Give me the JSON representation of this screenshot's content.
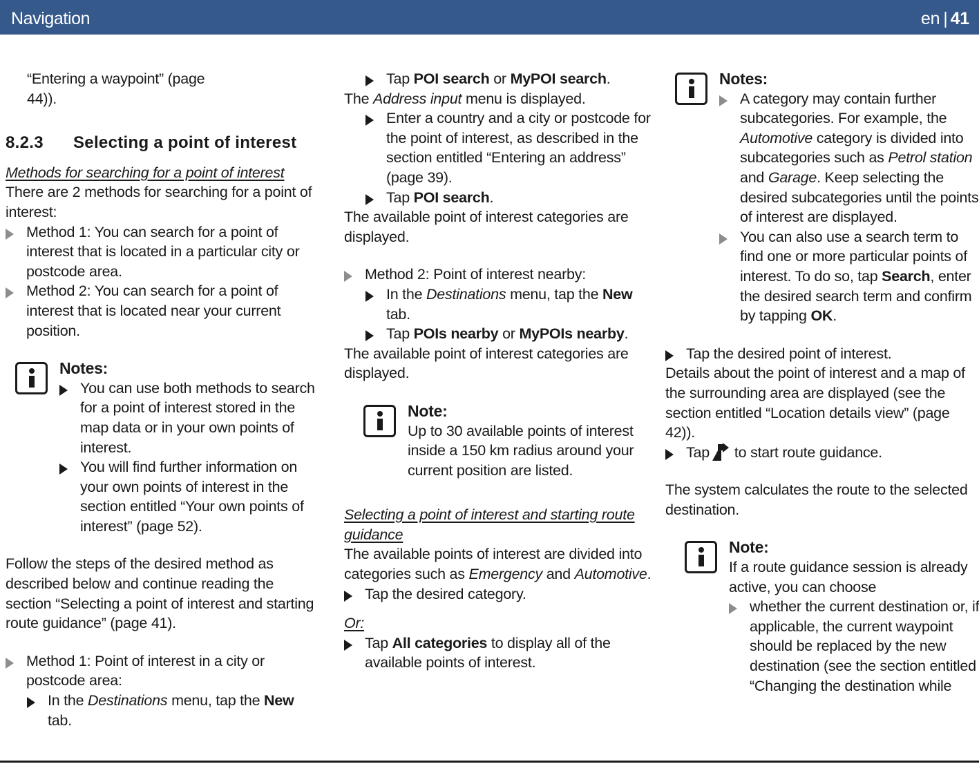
{
  "header": {
    "title": "Navigation",
    "language": "en",
    "separator": "|",
    "page_number": "41"
  },
  "column_1": {
    "continued_ref_line_1": "“Entering a waypoint” (page",
    "continued_ref_line_2": "44)).",
    "section_number": "8.2.3",
    "section_title": "Selecting a point of interest",
    "sub_heading": "Methods for searching for a point of interest",
    "intro_paragraph": "There are 2 methods for searching for a point of interest:",
    "method_1_bullet": "Method 1: You can search for a point of interest that is located in a particular city or postcode area.",
    "method_2_bullet": "Method 2: You can search for a point of interest that is located near your current position.",
    "notes_title": "Notes:",
    "note_bullet_1": "You can use both methods to search for a point of interest stored in the map data or in your own points of interest.",
    "note_bullet_2_a": "You will find further information on your own points of interest in the section entitled “Your own points of interest” (page 52).",
    "follow_paragraph": "Follow the steps of the desired method as described below and continue reading the section “Selecting a point of interest and starting route guidance” (page 41).",
    "method_1_step": "Method 1: Point of interest in a city or postcode area:",
    "step_in_destinations_a": "In the ",
    "step_in_destinations_italic": "Destinations",
    "step_in_destinations_b": " menu, tap the ",
    "step_in_destinations_bold": "New",
    "step_in_destinations_c": " tab."
  },
  "column_2": {
    "tap_poi_search_a": "Tap ",
    "tap_poi_search_bold_1": "POI search",
    "tap_poi_search_b": " or ",
    "tap_poi_search_bold_2": "MyPOI search",
    "tap_poi_search_c": ".",
    "address_input_a": "The ",
    "address_input_italic": "Address input",
    "address_input_b": " menu is displayed.",
    "enter_country_bullet": "Enter a country and a city or postcode for the point of interest, as described in the section entitled “Entering an address” (page 39).",
    "tap_poi_search_2_a": "Tap ",
    "tap_poi_search_2_bold": "POI search",
    "tap_poi_search_2_b": ".",
    "categories_displayed": "The available point of interest categories are displayed.",
    "method_2_step": "Method 2: Point of interest nearby:",
    "step_in_destinations_a": "In the ",
    "step_in_destinations_italic": "Destinations",
    "step_in_destinations_b": " menu, tap the ",
    "step_in_destinations_bold": "New",
    "step_in_destinations_c": " tab.",
    "tap_pois_nearby_a": "Tap ",
    "tap_pois_nearby_bold_1": "POIs nearby",
    "tap_pois_nearby_b": " or ",
    "tap_pois_nearby_bold_2": "MyPOIs nearby",
    "tap_pois_nearby_c": ".",
    "categories_displayed_2": "The available point of interest categories are displayed.",
    "note_title": "Note:",
    "note_body": "Up to 30 available points of interest inside a 150 km radius around your current position are listed.",
    "sub_heading": "Selecting a point of interest and starting route guidance",
    "divided_into_a": "The available points of interest are divided into categories such as ",
    "divided_into_italic_1": "Emergency",
    "divided_into_b": " and ",
    "divided_into_italic_2": "Automotive",
    "divided_into_c": ".",
    "tap_desired_category": "Tap the desired category.",
    "or_label": "Or:",
    "tap_all_categories_a": "Tap ",
    "tap_all_categories_bold": "All categories",
    "tap_all_categories_b": " to display all of the available points of interest."
  },
  "column_3": {
    "notes_title": "Notes:",
    "note_bullet_1_a": "A category may contain further subcategories. For example, the ",
    "note_bullet_1_italic_1": "Automotive",
    "note_bullet_1_b": " category is divided into subcategories such as ",
    "note_bullet_1_italic_2": "Petrol station",
    "note_bullet_1_c": " and ",
    "note_bullet_1_italic_3": "Garage",
    "note_bullet_1_d": ". Keep selecting the desired subcategories until the points of interest are displayed.",
    "note_bullet_2_a": "You can also use a search term to find one or more particular points of interest. To do so, tap ",
    "note_bullet_2_bold_1": "Search",
    "note_bullet_2_b": ", enter the desired search term and confirm by tapping ",
    "note_bullet_2_bold_2": "OK",
    "note_bullet_2_c": ".",
    "tap_desired_poi": "Tap the desired point of interest.",
    "details_paragraph": "Details about the point of interest and a map of the surrounding area are displayed (see the section entitled “Location details view” (page 42)).",
    "tap_route_guidance_a": "Tap",
    "tap_route_guidance_icon": "route-guidance-arrow-icon",
    "tap_route_guidance_b": "to start route guidance.",
    "system_calculates": "The system calculates the route to the selected destination.",
    "note_title": "Note:",
    "note_body": "If a route guidance session is already active, you can choose",
    "note_bullet_a": "whether the current destination or, if applicable, the current waypoint should be replaced by the new destination (see the section entitled “Changing the destination while"
  },
  "colors": {
    "header_background": "#35598a",
    "header_text": "#ffffff",
    "body_text": "#1a1a1a",
    "bullet_arrow_light": "#8d8d8d",
    "bullet_arrow_dark": "#1a1a1a"
  }
}
